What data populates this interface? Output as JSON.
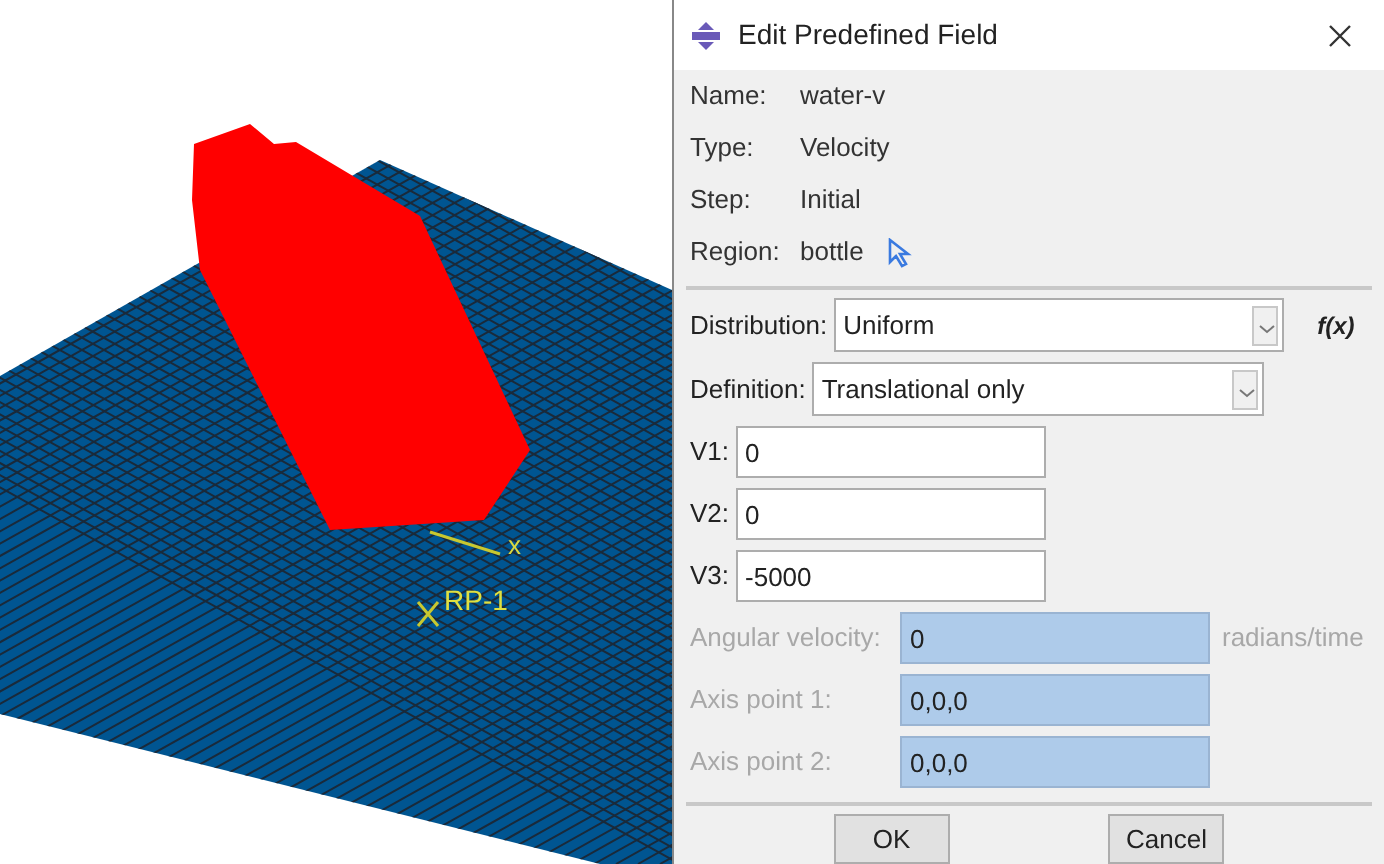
{
  "viewport": {
    "axis_label": "x",
    "reference_point": "RP-1"
  },
  "dialog": {
    "title": "Edit Predefined Field",
    "info": [
      {
        "label": "Name:",
        "value": "water-v"
      },
      {
        "label": "Type:",
        "value": "Velocity"
      },
      {
        "label": "Step:",
        "value": "Initial"
      },
      {
        "label": "Region:",
        "value": "bottle"
      }
    ],
    "distribution": {
      "label": "Distribution:",
      "value": "Uniform",
      "function_button": "f(x)"
    },
    "definition": {
      "label": "Definition:",
      "value": "Translational only"
    },
    "fields": [
      {
        "label": "V1:",
        "value": "0",
        "disabled": false
      },
      {
        "label": "V2:",
        "value": "0",
        "disabled": false
      },
      {
        "label": "V3:",
        "value": "-5000",
        "disabled": false
      },
      {
        "label": "Angular velocity:",
        "value": "0",
        "disabled": true,
        "unit": "radians/time"
      },
      {
        "label": "Axis point 1:",
        "value": "0,0,0",
        "disabled": true
      },
      {
        "label": "Axis point 2:",
        "value": "0,0,0",
        "disabled": true
      }
    ],
    "buttons": [
      "OK",
      "Cancel"
    ]
  }
}
